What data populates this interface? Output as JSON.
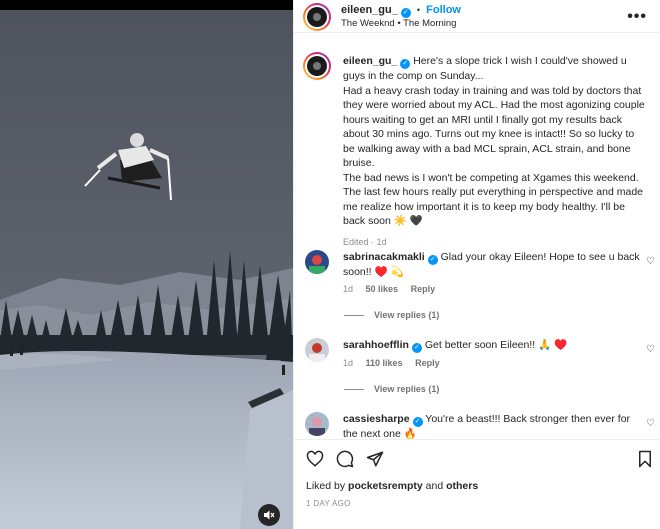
{
  "post": {
    "username": "eileen_gu_",
    "follow_label": "Follow",
    "dot": "•",
    "audio": "The Weeknd • The Morning",
    "caption_line1": "Here's a slope trick I wish I could've showed u guys in the comp on Sunday...",
    "caption_line2": "Had a heavy crash today in training and was told by doctors that they were worried about my ACL. Had the most agonizing couple hours waiting to get an MRI until I finally got my results back about 30 mins ago. Turns out my knee is intact!! So so lucky to be walking away with a bad MCL sprain, ACL strain, and bone bruise.",
    "caption_line3": "The bad news is I won't be competing at Xgames this weekend. The last few hours really put everything in perspective and made me realize how important it is to keep my body healthy. I'll be back soon ☀️ 🖤",
    "caption_meta": "Edited · 1d"
  },
  "comments": [
    {
      "username": "sabrinacakmakli",
      "text": "Glad your okay Eileen! Hope to see u back soon!! ♥️ 💫",
      "time": "1d",
      "likes": "50 likes",
      "reply": "Reply",
      "view_replies": "View replies (1)"
    },
    {
      "username": "sarahhoefflin",
      "text": "Get better soon Eileen!! 🙏 ♥️",
      "time": "1d",
      "likes": "110 likes",
      "reply": "Reply",
      "view_replies": "View replies (1)"
    },
    {
      "username": "cassiesharpe",
      "text": "You're a beast!!! Back stronger then ever for the next one 🔥"
    }
  ],
  "footer": {
    "liked_prefix": "Liked by",
    "liked_user": "pocketsrempty",
    "liked_and": "and",
    "liked_others": "others",
    "date": "1 DAY AGO"
  },
  "icons": {
    "more": "more-icon",
    "like": "heart-icon",
    "comment": "comment-icon",
    "share": "share-icon",
    "save": "bookmark-icon",
    "mute": "muted-speaker-icon"
  },
  "colors": {
    "accent": "#0095f6",
    "text": "#262626",
    "muted": "#8e8e8e"
  }
}
